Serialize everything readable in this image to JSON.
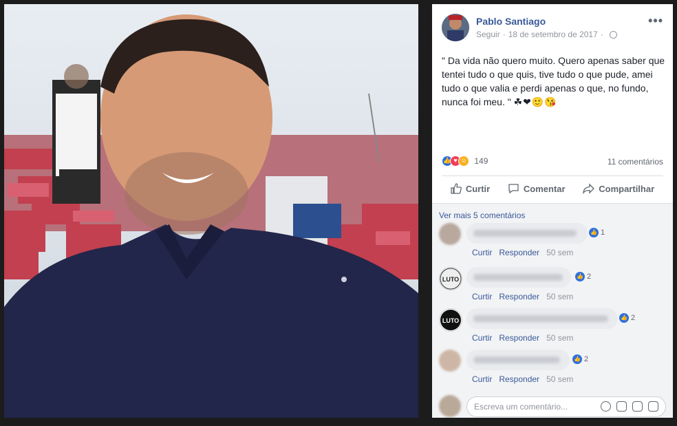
{
  "post": {
    "author": "Pablo Santiago",
    "follow_label": "Seguir",
    "date": "18 de setembro de 2017",
    "text": "\" Da vida não quero muito. Quero apenas saber que tentei tudo o que quis, tive tudo o que pude, amei tudo o que valia e perdi apenas o que, no fundo, nunca foi meu. \"",
    "emojis": "☘❤🙂😘",
    "more_options": "•••"
  },
  "stats": {
    "reactions_count": "149",
    "comments_count": "11 comentários"
  },
  "actions": {
    "like": "Curtir",
    "comment": "Comentar",
    "share": "Compartilhar"
  },
  "comments_section": {
    "see_more": "Ver mais 5 comentários",
    "items": [
      {
        "like_label": "Curtir",
        "reply_label": "Responder",
        "time": "50 sem",
        "reactions": "1"
      },
      {
        "like_label": "Curtir",
        "reply_label": "Responder",
        "time": "50 sem",
        "reactions": "2"
      },
      {
        "like_label": "Curtir",
        "reply_label": "Responder",
        "time": "50 sem",
        "reactions": "2"
      },
      {
        "like_label": "Curtir",
        "reply_label": "Responder",
        "time": "50 sem",
        "reactions": "2"
      }
    ],
    "composer_placeholder": "Escreva um comentário..."
  },
  "colors": {
    "link": "#385898",
    "like_blue": "#2e6fe0",
    "love_red": "#f33e58",
    "haha_yellow": "#f7b125"
  }
}
